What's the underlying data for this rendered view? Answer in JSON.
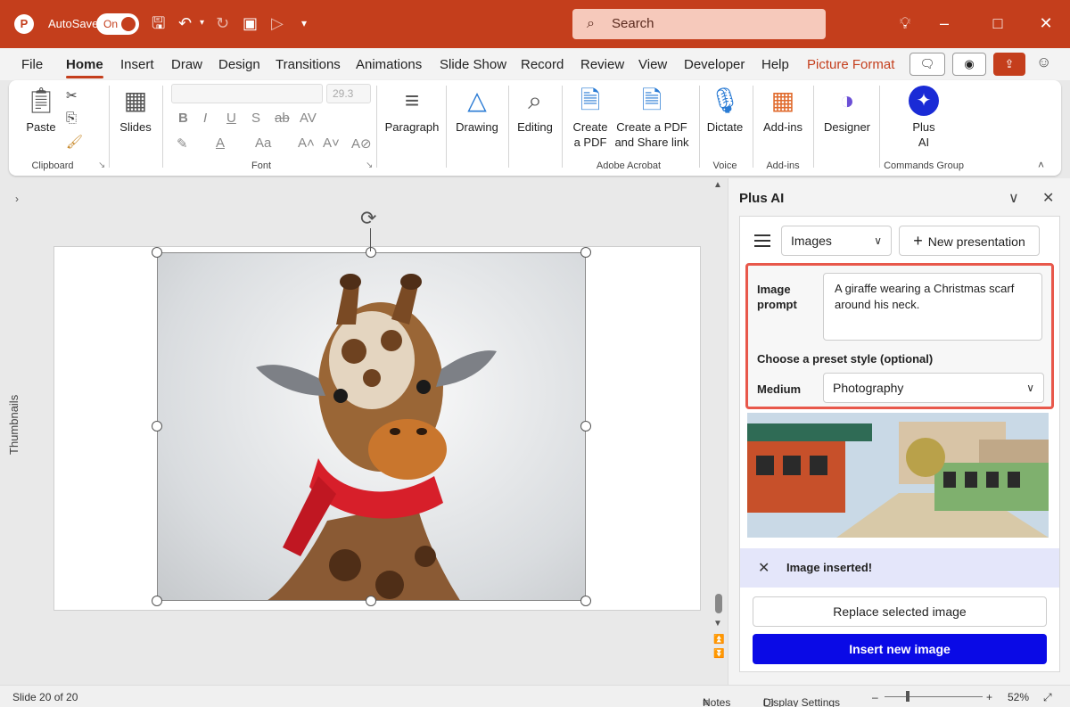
{
  "titlebar": {
    "autosave_label": "AutoSave",
    "autosave_state": "On",
    "search_placeholder": "Search"
  },
  "tabs": [
    "File",
    "Home",
    "Insert",
    "Draw",
    "Design",
    "Transitions",
    "Animations",
    "Slide Show",
    "Record",
    "Review",
    "View",
    "Developer",
    "Help",
    "Picture Format"
  ],
  "ribbon": {
    "paste": "Paste",
    "clipboard": "Clipboard",
    "slides": "Slides",
    "font_size": "29.3",
    "font_group": "Font",
    "paragraph": "Paragraph",
    "drawing": "Drawing",
    "editing": "Editing",
    "create_pdf_1": "Create",
    "create_pdf_2": "a PDF",
    "share_pdf_1": "Create a PDF",
    "share_pdf_2": "and Share link",
    "adobe_group": "Adobe Acrobat",
    "dictate": "Dictate",
    "voice_group": "Voice",
    "addins": "Add-ins",
    "addins_group": "Add-ins",
    "designer": "Designer",
    "plus_1": "Plus",
    "plus_2": "AI",
    "commands_group": "Commands Group"
  },
  "thumbnails_label": "Thumbnails",
  "pane": {
    "title": "Plus AI",
    "mode_select": "Images",
    "new_presentation": "New presentation",
    "image_prompt_label_1": "Image",
    "image_prompt_label_2": "prompt",
    "image_prompt_value": "A giraffe wearing a Christmas scarf around his neck.",
    "preset_label": "Choose a preset style (optional)",
    "medium_label": "Medium",
    "medium_value": "Photography",
    "toast_message": "Image inserted!",
    "replace_button": "Replace selected image",
    "insert_button": "Insert new image"
  },
  "status": {
    "slide_counter": "Slide 20 of 20",
    "notes": "Notes",
    "display_settings": "Display Settings",
    "zoom": "52%"
  },
  "colors": {
    "accent": "#c43e1c",
    "primary_button": "#0a0ae6",
    "highlight_border": "#e8584b"
  }
}
